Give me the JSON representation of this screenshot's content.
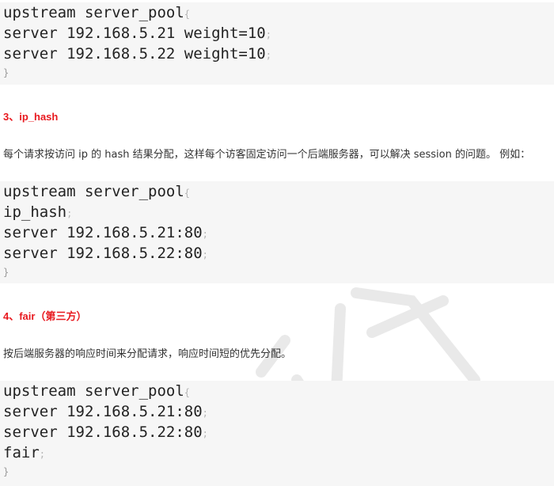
{
  "block1": {
    "lines": [
      {
        "text": "upstream server_pool",
        "punct": "{"
      },
      {
        "text": "server 192.168.5.21 weight=10",
        "punct": ";"
      },
      {
        "text": "server 192.168.5.22 weight=10",
        "punct": ";"
      }
    ],
    "close": "}"
  },
  "section3": {
    "heading": "3、ip_hash",
    "text": "每个请求按访问 ip 的 hash 结果分配，这样每个访客固定访问一个后端服务器，可以解决 session 的问题。 例如："
  },
  "block2": {
    "lines": [
      {
        "text": "upstream server_pool",
        "punct": "{"
      },
      {
        "text": "ip_hash",
        "punct": ";"
      },
      {
        "text": "server 192.168.5.21:80",
        "punct": ";"
      },
      {
        "text": "server 192.168.5.22:80",
        "punct": ";"
      }
    ],
    "close": "}"
  },
  "section4": {
    "heading": "4、fair（第三方）",
    "text": "按后端服务器的响应时间来分配请求，响应时间短的优先分配。"
  },
  "block3": {
    "lines": [
      {
        "text": "upstream server_pool",
        "punct": "{"
      },
      {
        "text": "server 192.168.5.21:80",
        "punct": ";"
      },
      {
        "text": "server 192.168.5.22:80",
        "punct": ";"
      },
      {
        "text": "fair",
        "punct": ";"
      }
    ],
    "close": "}"
  },
  "colors": {
    "heading": "#e8191f",
    "code_bg": "#f6f6f6",
    "body_text": "#333333"
  }
}
